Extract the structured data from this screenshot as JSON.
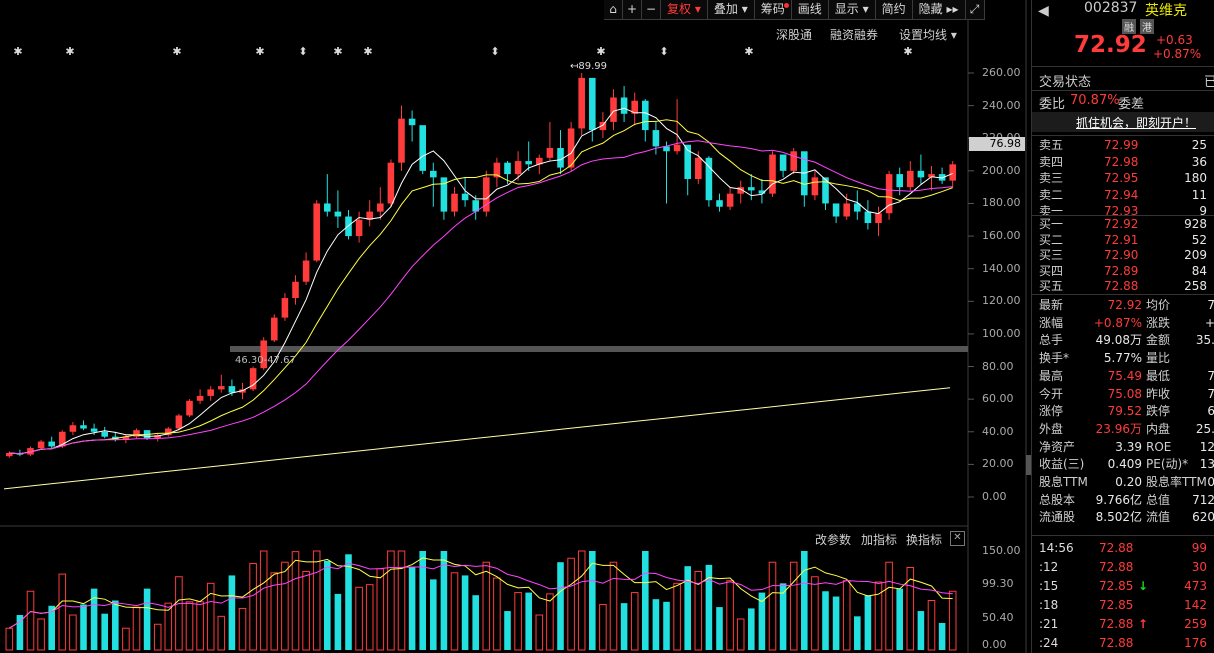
{
  "toolbar": {
    "buttons": [
      "复权",
      "叠加",
      "筹码",
      "画线",
      "显示",
      "简约",
      "隐藏"
    ],
    "active_index": 0
  },
  "secondary_bar": {
    "items": [
      "深股通",
      "融资融券",
      "设置均线"
    ]
  },
  "price_chart": {
    "y_ticks": [
      "260.00",
      "240.00",
      "220.00",
      "200.00",
      "180.00",
      "160.00",
      "140.00",
      "120.00",
      "100.00",
      "80.00",
      "60.00",
      "40.00",
      "20.00",
      "0.00"
    ],
    "current_price_label": "76.98",
    "max_annotation": "89.99",
    "gap_label": "46.30-47.67"
  },
  "volume_chart": {
    "toolbar": [
      "改参数",
      "加指标",
      "换指标"
    ],
    "y_ticks": [
      "150.00",
      "99.30",
      "50.40",
      "0.00"
    ]
  },
  "quote": {
    "code": "002837",
    "name": "英维克",
    "tags": [
      "融",
      "港"
    ],
    "price": "72.92",
    "change": "+0.63",
    "change_pct": "+0.87%",
    "trade_status_label": "交易状态",
    "trade_status_value": "已",
    "weibi_label": "委比",
    "weibi_value": "70.87%",
    "weicha_label": "委差",
    "promo": "抓住机会，即刻开户！",
    "sell": [
      {
        "label": "卖五",
        "price": "72.99",
        "vol": "25"
      },
      {
        "label": "卖四",
        "price": "72.98",
        "vol": "36"
      },
      {
        "label": "卖三",
        "price": "72.95",
        "vol": "180"
      },
      {
        "label": "卖二",
        "price": "72.94",
        "vol": "11"
      },
      {
        "label": "卖一",
        "price": "72.93",
        "vol": "9"
      }
    ],
    "buy": [
      {
        "label": "买一",
        "price": "72.92",
        "vol": "928"
      },
      {
        "label": "买二",
        "price": "72.91",
        "vol": "52"
      },
      {
        "label": "买三",
        "price": "72.90",
        "vol": "209"
      },
      {
        "label": "买四",
        "price": "72.89",
        "vol": "84"
      },
      {
        "label": "买五",
        "price": "72.88",
        "vol": "258"
      }
    ],
    "stats": [
      {
        "l1": "最新",
        "v1": "72.92",
        "c1": "red",
        "l2": "均价",
        "v2": "7"
      },
      {
        "l1": "涨幅",
        "v1": "+0.87%",
        "c1": "red",
        "l2": "涨跌",
        "v2": "+"
      },
      {
        "l1": "总手",
        "v1": "49.08万",
        "c1": "white",
        "l2": "金额",
        "v2": "35."
      },
      {
        "l1": "换手*",
        "v1": "5.77%",
        "c1": "white",
        "l2": "量比",
        "v2": ""
      },
      {
        "l1": "最高",
        "v1": "75.49",
        "c1": "red",
        "l2": "最低",
        "v2": "7"
      },
      {
        "l1": "今开",
        "v1": "75.08",
        "c1": "red",
        "l2": "昨收",
        "v2": "7"
      },
      {
        "l1": "涨停",
        "v1": "79.52",
        "c1": "red",
        "l2": "跌停",
        "v2": "6"
      },
      {
        "l1": "外盘",
        "v1": "23.96万",
        "c1": "red",
        "l2": "内盘",
        "v2": "25."
      },
      {
        "l1": "净资产",
        "v1": "3.39",
        "c1": "white",
        "l2": "ROE",
        "v2": "12"
      },
      {
        "l1": "收益(三)",
        "v1": "0.409",
        "c1": "white",
        "l2": "PE(动)*",
        "v2": "13"
      },
      {
        "l1": "股息TTM",
        "v1": "0.20",
        "c1": "white",
        "l2": "股息率TTM",
        "v2": "0"
      },
      {
        "l1": "总股本",
        "v1": "9.766亿",
        "c1": "white",
        "l2": "总值",
        "v2": "712"
      },
      {
        "l1": "流通股",
        "v1": "8.502亿",
        "c1": "white",
        "l2": "流值",
        "v2": "620"
      }
    ],
    "ticks": [
      {
        "time": "14:56",
        "price": "72.88",
        "vol": "99",
        "arrow": ""
      },
      {
        "time": ":12",
        "price": "72.88",
        "vol": "30",
        "arrow": ""
      },
      {
        "time": ":15",
        "price": "72.85",
        "vol": "473",
        "arrow": "↓"
      },
      {
        "time": ":18",
        "price": "72.85",
        "vol": "142",
        "arrow": ""
      },
      {
        "time": ":21",
        "price": "72.88",
        "vol": "259",
        "arrow": "↑"
      },
      {
        "time": ":24",
        "price": "72.88",
        "vol": "176",
        "arrow": ""
      }
    ]
  },
  "chart_data": {
    "type": "candlestick",
    "price_range": [
      0,
      260
    ],
    "candles": [
      [
        25,
        28,
        24,
        27
      ],
      [
        27,
        29,
        25,
        26
      ],
      [
        26,
        31,
        25,
        30
      ],
      [
        30,
        35,
        29,
        34
      ],
      [
        34,
        37,
        30,
        31
      ],
      [
        31,
        41,
        30,
        40
      ],
      [
        40,
        46,
        38,
        44
      ],
      [
        44,
        47,
        41,
        42
      ],
      [
        42,
        45,
        38,
        40
      ],
      [
        40,
        43,
        36,
        37
      ],
      [
        37,
        40,
        34,
        35
      ],
      [
        35,
        38,
        33,
        37
      ],
      [
        37,
        42,
        36,
        41
      ],
      [
        41,
        40,
        35,
        36
      ],
      [
        36,
        39,
        34,
        38
      ],
      [
        38,
        43,
        37,
        42
      ],
      [
        42,
        51,
        41,
        50
      ],
      [
        50,
        60,
        49,
        59
      ],
      [
        59,
        66,
        57,
        62
      ],
      [
        62,
        68,
        59,
        66
      ],
      [
        66,
        75,
        64,
        68
      ],
      [
        68,
        72,
        62,
        64
      ],
      [
        64,
        70,
        60,
        66
      ],
      [
        66,
        80,
        65,
        79
      ],
      [
        79,
        98,
        78,
        96
      ],
      [
        96,
        112,
        95,
        110
      ],
      [
        110,
        125,
        108,
        122
      ],
      [
        122,
        136,
        118,
        132
      ],
      [
        132,
        150,
        130,
        145
      ],
      [
        145,
        182,
        144,
        180
      ],
      [
        180,
        198,
        172,
        175
      ],
      [
        175,
        188,
        165,
        172
      ],
      [
        172,
        176,
        158,
        160
      ],
      [
        160,
        175,
        156,
        170
      ],
      [
        170,
        182,
        166,
        175
      ],
      [
        175,
        190,
        170,
        180
      ],
      [
        180,
        207,
        178,
        205
      ],
      [
        205,
        240,
        200,
        232
      ],
      [
        232,
        237,
        218,
        228
      ],
      [
        228,
        225,
        198,
        200
      ],
      [
        200,
        205,
        178,
        196
      ],
      [
        196,
        192,
        170,
        175
      ],
      [
        175,
        190,
        172,
        186
      ],
      [
        186,
        196,
        178,
        182
      ],
      [
        182,
        185,
        170,
        175
      ],
      [
        175,
        200,
        172,
        196
      ],
      [
        196,
        208,
        190,
        205
      ],
      [
        205,
        206,
        192,
        198
      ],
      [
        198,
        212,
        194,
        206
      ],
      [
        206,
        218,
        200,
        204
      ],
      [
        204,
        210,
        198,
        208
      ],
      [
        208,
        230,
        206,
        214
      ],
      [
        214,
        225,
        198,
        202
      ],
      [
        202,
        230,
        200,
        226
      ],
      [
        226,
        260,
        222,
        257
      ],
      [
        257,
        244,
        218,
        225
      ],
      [
        225,
        236,
        220,
        230
      ],
      [
        230,
        250,
        225,
        245
      ],
      [
        245,
        252,
        230,
        235
      ],
      [
        235,
        248,
        228,
        243
      ],
      [
        243,
        244,
        218,
        225
      ],
      [
        225,
        230,
        210,
        215
      ],
      [
        215,
        218,
        180,
        212
      ],
      [
        212,
        244,
        210,
        216
      ],
      [
        216,
        213,
        185,
        195
      ],
      [
        195,
        212,
        192,
        208
      ],
      [
        208,
        209,
        178,
        182
      ],
      [
        182,
        186,
        175,
        178
      ],
      [
        178,
        190,
        176,
        186
      ],
      [
        186,
        194,
        180,
        190
      ],
      [
        190,
        198,
        182,
        188
      ],
      [
        188,
        195,
        180,
        186
      ],
      [
        186,
        212,
        184,
        210
      ],
      [
        210,
        206,
        196,
        200
      ],
      [
        200,
        214,
        198,
        212
      ],
      [
        212,
        198,
        178,
        185
      ],
      [
        185,
        200,
        182,
        196
      ],
      [
        196,
        186,
        176,
        180
      ],
      [
        180,
        178,
        168,
        172
      ],
      [
        172,
        186,
        170,
        180
      ],
      [
        180,
        188,
        170,
        175
      ],
      [
        175,
        182,
        164,
        168
      ],
      [
        168,
        178,
        160,
        174
      ],
      [
        174,
        200,
        170,
        198
      ],
      [
        198,
        202,
        185,
        190
      ],
      [
        190,
        206,
        188,
        200
      ],
      [
        200,
        210,
        192,
        196
      ],
      [
        196,
        203,
        188,
        198
      ],
      [
        198,
        202,
        192,
        194
      ],
      [
        194,
        206,
        190,
        204
      ]
    ]
  }
}
